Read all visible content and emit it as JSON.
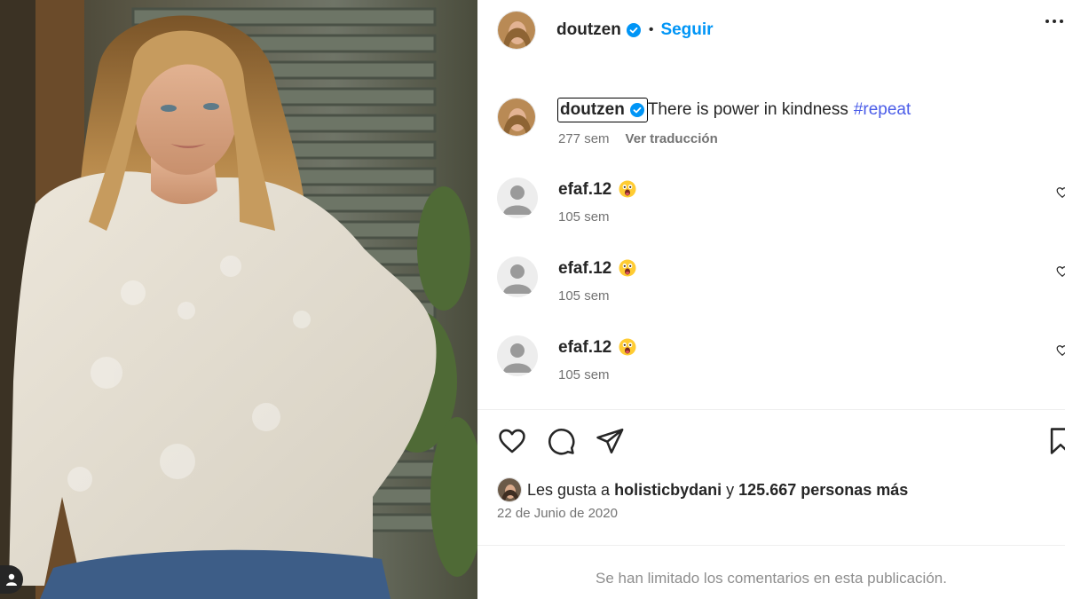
{
  "post": {
    "author": "doutzen",
    "follow_label": "Seguir",
    "separator": "•",
    "more_icon": "more-options-icon"
  },
  "caption": {
    "username": "doutzen",
    "text": "There is power in kindness",
    "hashtag": "#repeat",
    "time": "277 sem",
    "translate_label": "Ver traducción"
  },
  "comments": [
    {
      "username": "efaf.12",
      "emoji": "astonished-face",
      "time": "105 sem"
    },
    {
      "username": "efaf.12",
      "emoji": "astonished-face",
      "time": "105 sem"
    },
    {
      "username": "efaf.12",
      "emoji": "astonished-face",
      "time": "105 sem"
    }
  ],
  "likes": {
    "prefix": "Les gusta a",
    "user": "holisticbydani",
    "conjunction": "y",
    "others": "125.667 personas más"
  },
  "date": "22 de Junio de 2020",
  "limited_notice": "Se han limitado los comentarios en esta publicación.",
  "colors": {
    "link_blue": "#0095f6",
    "hashtag": "#4a5ce8",
    "verified": "#0095f6",
    "muted": "#737373"
  },
  "icons": [
    "heart-icon",
    "comment-icon",
    "share-icon",
    "save-icon",
    "verified-badge-icon",
    "tag-user-icon"
  ]
}
